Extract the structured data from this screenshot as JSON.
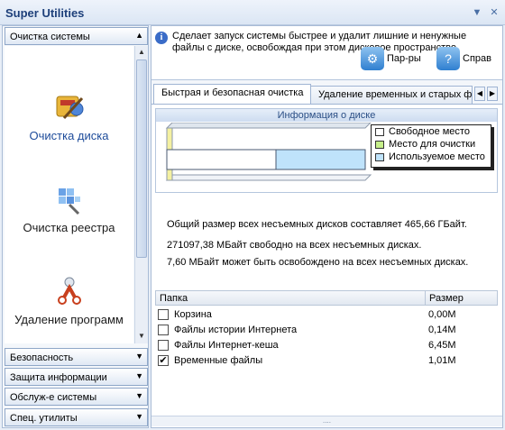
{
  "window": {
    "title": "Super Utilities",
    "buttons": [
      "▼",
      "✕"
    ]
  },
  "sidebar": {
    "current_category": "Очистка системы",
    "tools": [
      {
        "label": "Очистка диска",
        "icon": "disk-cleanup-icon",
        "active": true
      },
      {
        "label": "Очистка реестра",
        "icon": "registry-cleaner-icon"
      },
      {
        "label": "Удаление программ",
        "icon": "uninstall-programs-icon"
      }
    ],
    "categories": [
      {
        "label": "Безопасность"
      },
      {
        "label": "Защита информации"
      },
      {
        "label": "Обслуж-е системы"
      },
      {
        "label": "Спец. утилиты"
      }
    ]
  },
  "info": {
    "text": "Сделает запуск системы быстрее и удалит лишние и ненужные файлы с диске, освобождая при этом дисковое пространство.",
    "settings_label": "Пар-ры",
    "help_label": "Справ"
  },
  "tabs": [
    {
      "label": "Быстрая и безопасная очистка",
      "active": true
    },
    {
      "label": "Удаление временных и старых файлов"
    }
  ],
  "disk": {
    "title": "Информация о диске",
    "legend": [
      {
        "label": "Свободное место",
        "color": "#ffffff"
      },
      {
        "label": "Место для очистки",
        "color": "#c6ef8a"
      },
      {
        "label": "Используемое место",
        "color": "#bfe3fb"
      }
    ],
    "free_fraction": 0.55,
    "cleanup_fraction": 0.0,
    "used_fraction": 0.45
  },
  "stats": {
    "line1": "Общий размер всех несъемных дисков составляет 465,66 ГБайт.",
    "line2": "271097,38 МБайт свободно на всех несъемных дисках.",
    "line3": "7,60 МБайт может быть освобождено на всех несъемных дисках."
  },
  "grid": {
    "col_folder": "Папка",
    "col_size": "Размер",
    "rows": [
      {
        "name": "Корзина",
        "size": "0,00M",
        "checked": false
      },
      {
        "name": "Файлы истории Интернета",
        "size": "0,14M",
        "checked": false
      },
      {
        "name": "Файлы Интернет-кеша",
        "size": "6,45M",
        "checked": false
      },
      {
        "name": "Временные файлы",
        "size": "1,01M",
        "checked": true
      }
    ]
  }
}
